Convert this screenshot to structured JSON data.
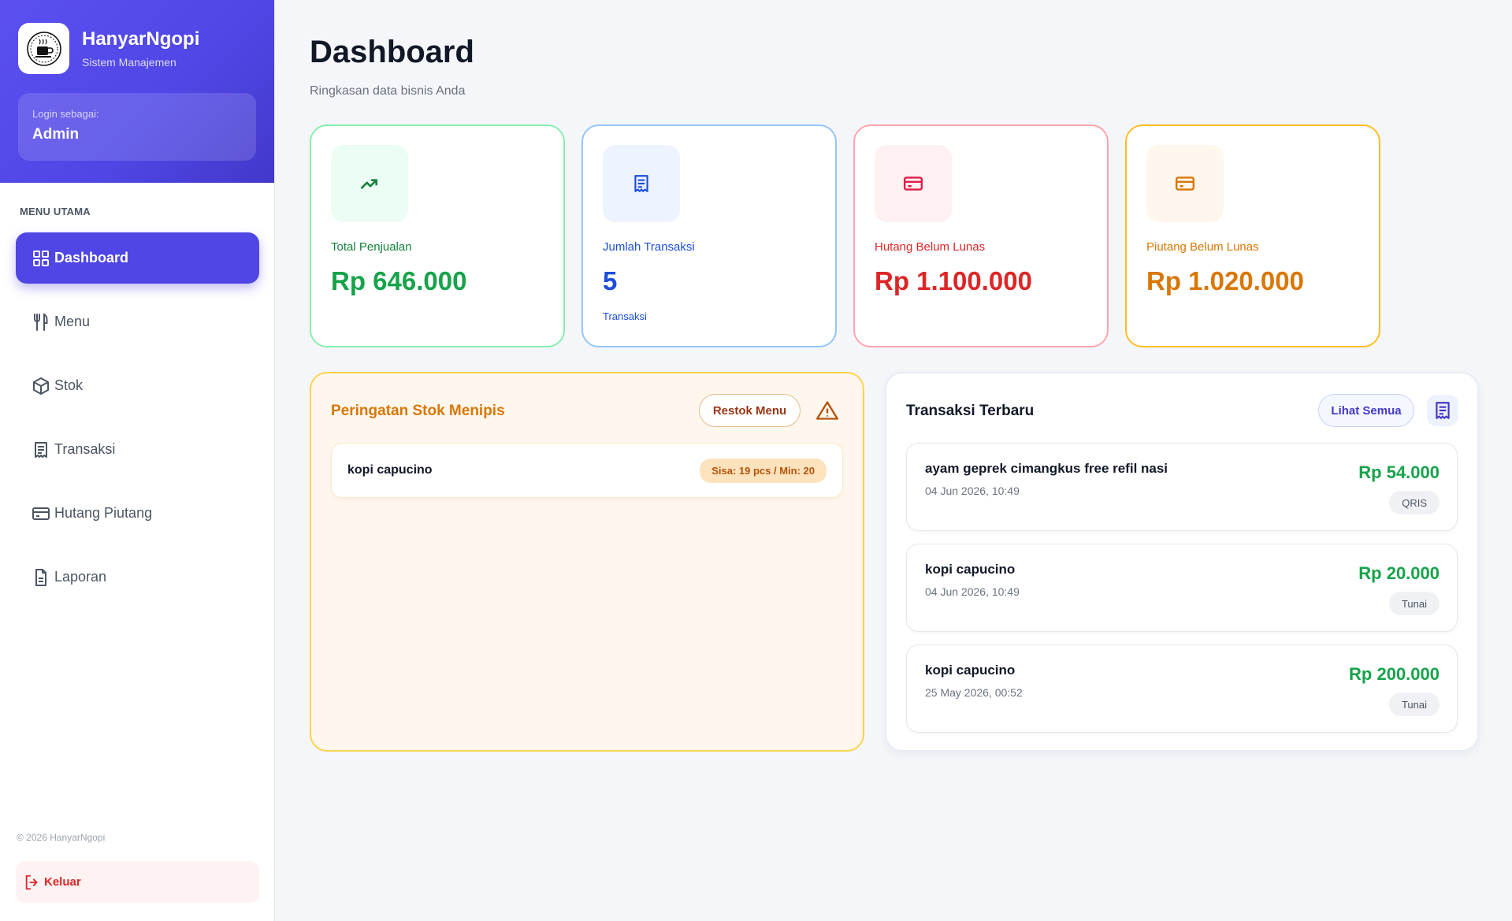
{
  "brand": {
    "name": "HanyarNgopi",
    "subtitle": "Sistem Manajemen"
  },
  "login": {
    "label": "Login sebagai:",
    "user": "Admin"
  },
  "sidebar": {
    "section_title": "MENU UTAMA",
    "items": [
      {
        "label": "Dashboard",
        "icon": "grid-icon",
        "active": true
      },
      {
        "label": "Menu",
        "icon": "utensils-icon"
      },
      {
        "label": "Stok",
        "icon": "box-icon"
      },
      {
        "label": "Transaksi",
        "icon": "receipt-icon"
      },
      {
        "label": "Hutang Piutang",
        "icon": "credit-card-icon"
      },
      {
        "label": "Laporan",
        "icon": "document-icon"
      }
    ],
    "copyright": "© 2026 HanyarNgopi",
    "logout": "Keluar"
  },
  "header": {
    "title": "Dashboard",
    "subtitle": "Ringkasan data bisnis Anda"
  },
  "stats": [
    {
      "label": "Total Penjualan",
      "value": "Rp 646.000",
      "note": "",
      "icon": "trending-up-icon",
      "color": "#16a34a"
    },
    {
      "label": "Jumlah Transaksi",
      "value": "5",
      "note": "Transaksi",
      "icon": "receipt-icon",
      "color": "#1d4ed8"
    },
    {
      "label": "Hutang Belum Lunas",
      "value": "Rp 1.100.000",
      "note": "",
      "icon": "credit-card-icon",
      "color": "#dc2626"
    },
    {
      "label": "Piutang Belum Lunas",
      "value": "Rp 1.020.000",
      "note": "",
      "icon": "credit-card-icon",
      "color": "#d97706"
    }
  ],
  "stock_warning": {
    "title": "Peringatan Stok Menipis",
    "restock_label": "Restok Menu",
    "icon": "warning-icon",
    "items": [
      {
        "name": "kopi capucino",
        "badge": "Sisa: 19 pcs / Min: 20"
      }
    ]
  },
  "transactions": {
    "title": "Transaksi Terbaru",
    "view_all_label": "Lihat Semua",
    "icon": "receipt-icon",
    "items": [
      {
        "name": "ayam geprek cimangkus free refil nasi",
        "date": "04 Jun 2026, 10:49",
        "amount": "Rp 54.000",
        "method": "QRIS"
      },
      {
        "name": "kopi capucino",
        "date": "04 Jun 2026, 10:49",
        "amount": "Rp 20.000",
        "method": "Tunai"
      },
      {
        "name": "kopi capucino",
        "date": "25 May 2026, 00:52",
        "amount": "Rp 200.000",
        "method": "Tunai"
      }
    ]
  }
}
